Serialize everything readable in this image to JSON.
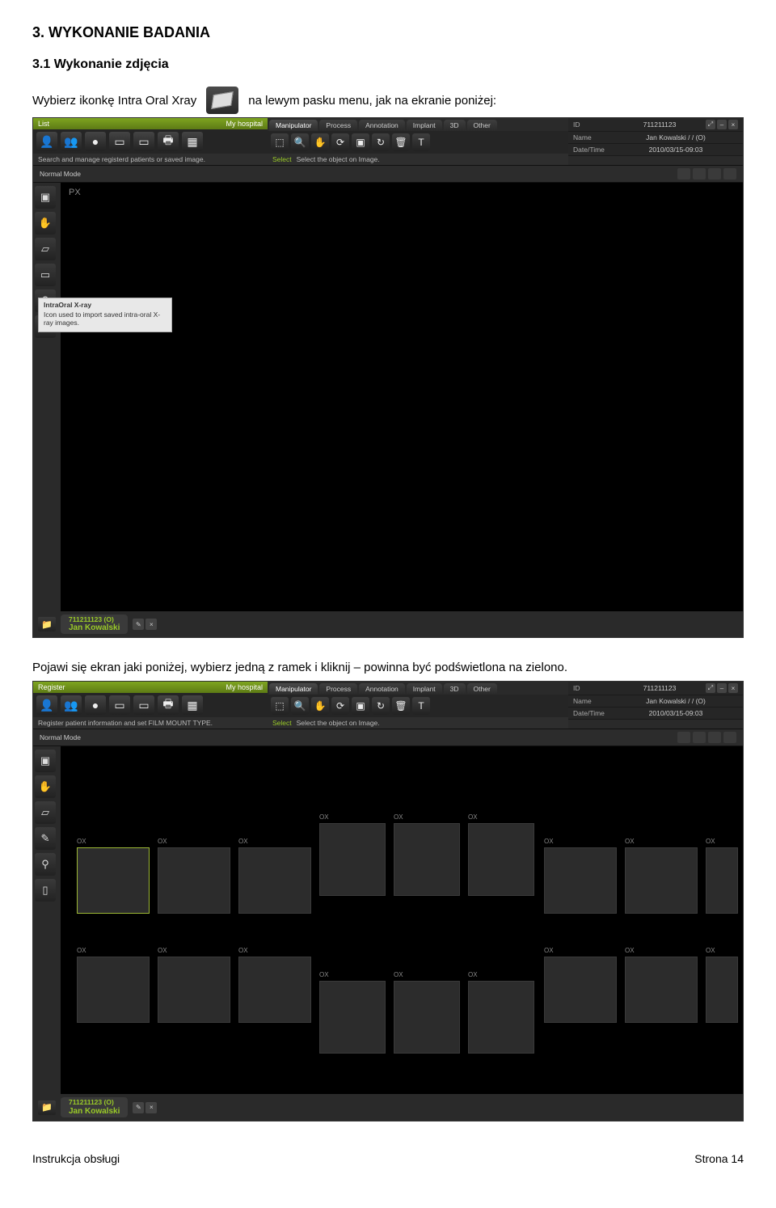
{
  "doc": {
    "heading": "3. WYKONANIE BADANIA",
    "subheading": "3.1 Wykonanie zdjęcia",
    "para_pre": "Wybierz ikonkę Intra Oral Xray",
    "para_post": "na lewym pasku menu, jak na ekranie poniżej:",
    "para2": "Pojawi się ekran jaki poniżej, wybierz jedną z ramek i kliknij – powinna być podświetlona na zielono.",
    "footer_left": "Instrukcja obsługi",
    "footer_right": "Strona 14"
  },
  "common": {
    "hospital": "My hospital",
    "tabs": [
      "Manipulator",
      "Process",
      "Annotation",
      "Implant",
      "3D",
      "Other"
    ],
    "select_label": "Select",
    "select_text": "Select the object on Image.",
    "info_id_label": "ID",
    "info_id_value": "711211123",
    "info_name_label": "Name",
    "info_name_value": "Jan Kowalski / / (O)",
    "info_dt_label": "Date/Time",
    "info_dt_value": "2010/03/15-09:03",
    "mode": "Normal Mode",
    "patient_id": "711211123 (O)",
    "patient_name": "Jan Kowalski",
    "slot_label": "OX"
  },
  "shot1": {
    "list_label": "List",
    "status": "Search and manage registerd patients or saved image.",
    "px": "PX",
    "tooltip_title": "IntraOral X-ray",
    "tooltip_body": "Icon used to import saved intra-oral X-ray images."
  },
  "shot2": {
    "list_label": "Register",
    "status": "Register patient information and set FILM MOUNT TYPE."
  }
}
